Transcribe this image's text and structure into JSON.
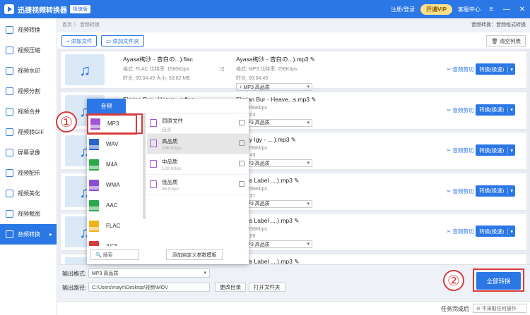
{
  "app": {
    "title": "迅捷视频转换器",
    "edition": "极速版"
  },
  "titlebar": {
    "login": "注册/登录",
    "vip": "开通VIP",
    "service": "客服中心",
    "win_icons": [
      "menu-icon",
      "minimize-icon",
      "close-icon"
    ]
  },
  "sidebar": {
    "items": [
      {
        "label": "视频转换"
      },
      {
        "label": "视频压缩"
      },
      {
        "label": "视频水印"
      },
      {
        "label": "视频分割"
      },
      {
        "label": "视频合并"
      },
      {
        "label": "视频转GIF"
      },
      {
        "label": "屏幕录像"
      },
      {
        "label": "视频配乐"
      },
      {
        "label": "视频美化"
      },
      {
        "label": "视频截图"
      },
      {
        "label": "音频转换",
        "active": true
      }
    ]
  },
  "breadcrumb": {
    "path": "首页 〉 音频转换",
    "right": "音频转换：音频格式转换"
  },
  "toolbar": {
    "add_file": "+ 添加文件",
    "add_folder": "添加文件夹",
    "clear": "清空列表"
  },
  "files": [
    {
      "src_name": "Ayasa绚沙 - 杏白の...).flac",
      "src_meta1": "格式:   FLAC     比特率: 1560Kbps",
      "src_meta2": "时长:   00:04:49    大小:   53.82 MB",
      "dst_name": "Ayasa绚沙 - 杏白の...).mp3",
      "dst_meta1": "格式:   MP3      比特率: 256Kbps",
      "dst_meta2": "时长:   00:04:49",
      "dst_fmt": "MP3  高品质",
      "cut": "音频剪切",
      "convert": "转换(极速)"
    },
    {
      "src_name": "Florian Bur - Heave...s.flac",
      "dst_name": "Florian Bur - Heave...s.mp3",
      "dst_meta1": "MP3     256Kbps",
      "dst_meta2": "00:03:03",
      "dst_fmt": "MP3  高品质",
      "cut": "音频剪切",
      "convert": "转换(极速)"
    },
    {
      "dst_name": "- Tony Igy - ....).mp3",
      "dst_meta1": "MP3     256Kbps",
      "dst_meta2": "00:03:43",
      "dst_fmt": "MP3  高品质",
      "cut": "音频剪切",
      "convert": "转换(极速)"
    },
    {
      "dst_name": "ounds Label ....).mp3",
      "dst_meta1": "MP3     256Kbps",
      "dst_meta2": "00:02:37",
      "dst_fmt": "MP3  高品质",
      "cut": "音频剪切",
      "convert": "转换(极速)"
    },
    {
      "dst_name": "ounds Label ....).mp3",
      "dst_meta1": "MP3     256Kbps",
      "dst_meta2": "00:02:09",
      "dst_fmt": "MP3  高品质",
      "cut": "音频剪切",
      "convert": "转换(极速)"
    },
    {
      "dst_name": "ounds Label ....).mp3",
      "dst_meta1": "MP3     256Kbps",
      "dst_meta2": "00:03:01",
      "dst_fmt": "MP3  高品质",
      "cut": "音频剪切",
      "convert": "转换(极速)"
    }
  ],
  "popup": {
    "tab": "音频",
    "formats": [
      {
        "name": "MP3",
        "color": "#a256d6"
      },
      {
        "name": "WAV",
        "color": "#2b63c9"
      },
      {
        "name": "M4A",
        "color": "#2aa84a"
      },
      {
        "name": "WMA",
        "color": "#8a4fd1"
      },
      {
        "name": "AAC",
        "color": "#2aa84a"
      },
      {
        "name": "FLAC",
        "color": "#f0b21a"
      },
      {
        "name": "AC3",
        "color": "#d93b3b"
      }
    ],
    "qualities": [
      {
        "name": "同原文件",
        "rate": "自适"
      },
      {
        "name": "高品质",
        "rate": "256 Kbps"
      },
      {
        "name": "中品质",
        "rate": "128 Kbps"
      },
      {
        "name": "低品质",
        "rate": "96 Kbps"
      }
    ],
    "search_placeholder": "搜索",
    "custom_button": "添加自定义参数模板"
  },
  "output": {
    "format_label": "输出格式:",
    "format_value": "MP3  高品质",
    "path_label": "输出路径:",
    "path_value": "C:\\Users\\mayn\\Desktop\\视频\\MOV",
    "change_dir": "更改目录",
    "open_folder": "打开文件夹",
    "convert_all": "全部转换"
  },
  "status": {
    "done_label": "任务完成后",
    "action": "不采取任何操作"
  },
  "callouts": {
    "one": "①",
    "two": "②"
  },
  "colors": {
    "accent": "#2b77e5",
    "callout": "#d93b3b"
  }
}
